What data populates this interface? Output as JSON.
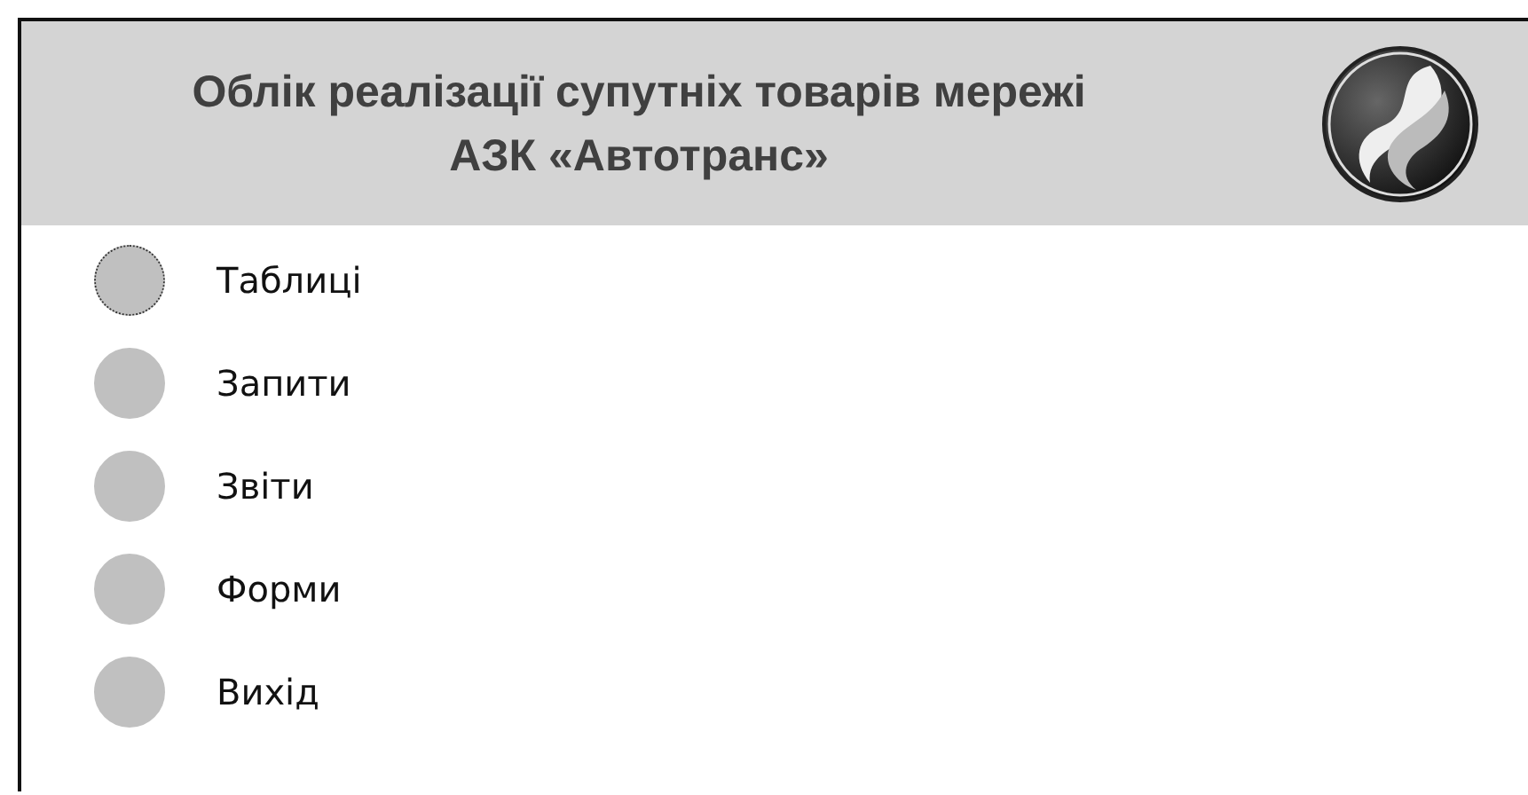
{
  "header": {
    "title_lines": [
      "Облік реалізації супутніх товарів мережі",
      "АЗК «Автотранс»"
    ]
  },
  "menu": [
    {
      "label": "Таблиці",
      "selected": true
    },
    {
      "label": "Запити",
      "selected": false
    },
    {
      "label": "Звіти",
      "selected": false
    },
    {
      "label": "Форми",
      "selected": false
    },
    {
      "label": "Вихід",
      "selected": false
    }
  ]
}
